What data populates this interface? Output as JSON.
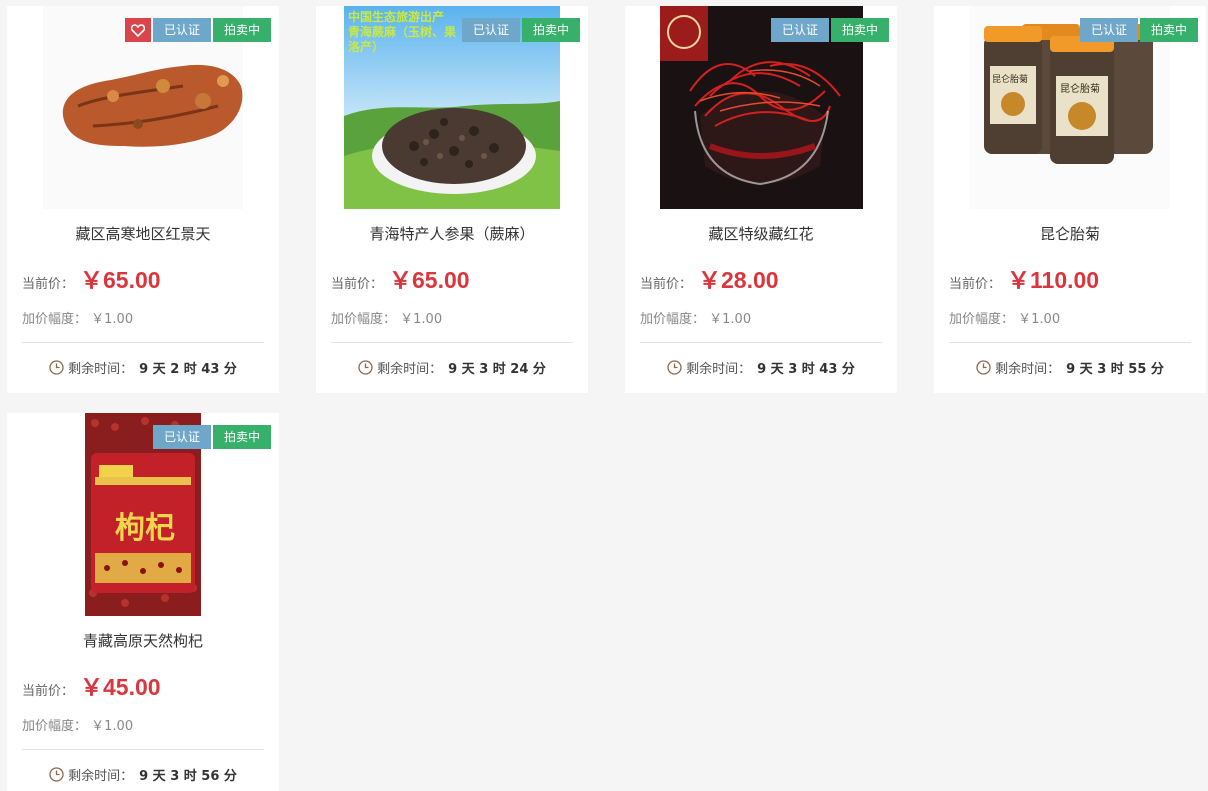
{
  "labels": {
    "verified": "已认证",
    "auction": "拍卖中",
    "current_price": "当前价：",
    "increment": "加价幅度：",
    "remaining": "剩余时间："
  },
  "colors": {
    "price": "#d9373d",
    "verified_badge": "#6ea7c9",
    "auction_badge": "#37b06b",
    "favorite_badge": "#d9454a"
  },
  "products": [
    {
      "title": "藏区高寒地区红景天",
      "price": "￥65.00",
      "increment": "￥1.00",
      "time": "9 天 2 时 43 分",
      "favorite": true,
      "image": "rhodiola-root"
    },
    {
      "title": "青海特产人参果（蕨麻）",
      "price": "￥65.00",
      "increment": "￥1.00",
      "time": "9 天 3 时 24 分",
      "favorite": false,
      "image": "silverweed-root",
      "image_text": "中国生态旅游出产 青海蕨麻（玉树、果洛产）"
    },
    {
      "title": "藏区特级藏红花",
      "price": "￥28.00",
      "increment": "￥1.00",
      "time": "9 天 3 时 43 分",
      "favorite": false,
      "image": "saffron-bowl"
    },
    {
      "title": "昆仑胎菊",
      "price": "￥110.00",
      "increment": "￥1.00",
      "time": "9 天 3 时 55 分",
      "favorite": false,
      "image": "chrysanthemum-jars",
      "image_text": "昆仑胎菊"
    },
    {
      "title": "青藏高原天然枸杞",
      "price": "￥45.00",
      "increment": "￥1.00",
      "time": "9 天 3 时 56 分",
      "favorite": false,
      "image": "goji-bag",
      "image_text": "枸杞"
    }
  ]
}
